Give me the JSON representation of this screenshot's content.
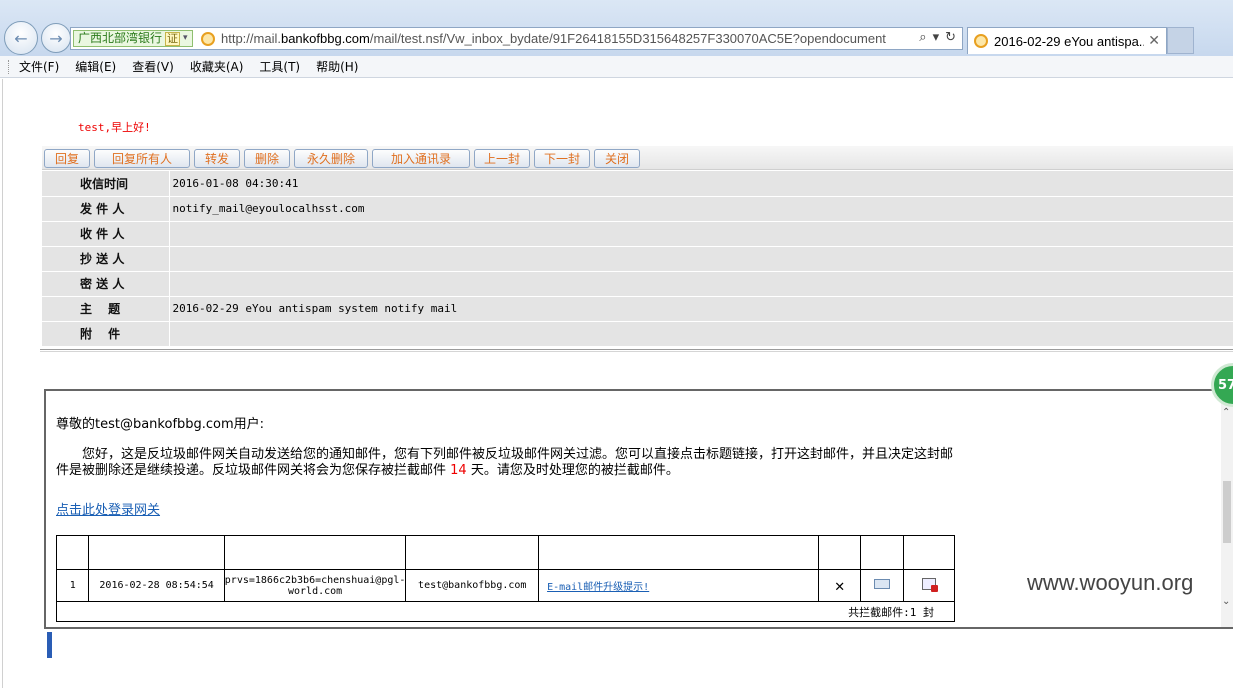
{
  "browser": {
    "site_badge": "广西北部湾银行",
    "cert_label": "证",
    "url_prefix": "http://mail.",
    "url_domain": "bankofbbg.com",
    "url_suffix": "/mail/test.nsf/Vw_inbox_bydate/91F26418155D315648257F330070AC5E?opendocument",
    "tab_title": "2016-02-29 eYou antispa...",
    "menu": [
      "文件(F)",
      "编辑(E)",
      "查看(V)",
      "收藏夹(A)",
      "工具(T)",
      "帮助(H)"
    ]
  },
  "greeting": "test,早上好!",
  "toolbar": {
    "reply": "回复",
    "reply_all": "回复所有人",
    "forward": "转发",
    "delete": "删除",
    "perm_delete": "永久删除",
    "add_contacts": "加入通讯录",
    "prev": "上一封",
    "next": "下一封",
    "close": "关闭"
  },
  "header": {
    "received_label": "收信时间",
    "received_value": "2016-01-08 04:30:41",
    "from_label": "发 件 人",
    "from_value": "notify_mail@eyoulocalhsst.com",
    "to_label": "收 件 人",
    "to_value": "",
    "cc_label": "抄 送 人",
    "cc_value": "",
    "bcc_label": "密 送 人",
    "bcc_value": "",
    "subject_label": "主　 题",
    "subject_value": "2016-02-29 eYou antispam system notify mail",
    "attach_label": "附　 件",
    "attach_value": ""
  },
  "body": {
    "salutation": "尊敬的test@bankofbbg.com用户:",
    "notice_part1": "　　您好，这是反垃圾邮件网关自动发送给您的通知邮件，您有下列邮件被反垃圾邮件网关过滤。您可以直接点击标题链接，打开这封邮件，并且决定这封邮件是被删除还是继续投递。反垃圾邮件网关将会为您保存被拦截邮件",
    "notice_days": " 14 ",
    "notice_part2": "天。请您及时处理您的被拦截邮件。",
    "gateway_link": "点击此处登录网关",
    "mail_rows": [
      {
        "index": "1",
        "date": "2016-02-28 08:54:54",
        "sender": "prvs=1866c2b3b6=chenshuai@pgl-world.com",
        "recipient": "test@bankofbbg.com",
        "subject": "E-mail邮件升级提示!"
      }
    ],
    "total": "共拦截邮件:1 封"
  },
  "overlay": {
    "badge": "57",
    "watermark": "www.wooyun.org"
  }
}
